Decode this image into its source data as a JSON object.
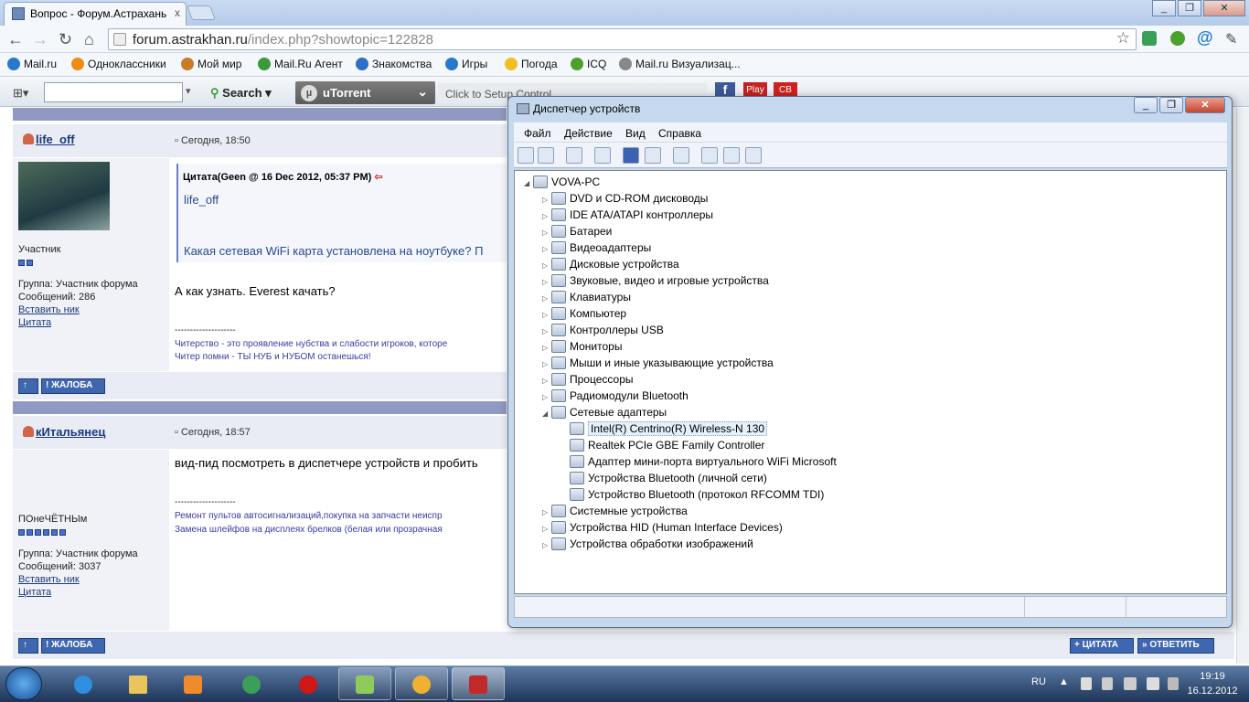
{
  "browser": {
    "tab_title": "Вопрос - Форум.Астрахань",
    "tab_close": "x",
    "url_host": "forum.astrakhan.ru",
    "url_path": "/index.php?showtopic=122828",
    "bookmarks": [
      {
        "label": "Mail.ru",
        "color": "#2a79c9"
      },
      {
        "label": "Одноклассники",
        "color": "#f08c12"
      },
      {
        "label": "Мой мир",
        "color": "#c87c2a"
      },
      {
        "label": "Mail.Ru Агент",
        "color": "#3a9a3a"
      },
      {
        "label": "Знакомства",
        "color": "#2a6fc9"
      },
      {
        "label": "Игры",
        "color": "#2a79c9"
      },
      {
        "label": "Погода",
        "color": "#f0c020"
      },
      {
        "label": "ICQ",
        "color": "#4ca02c"
      },
      {
        "label": "Mail.ru Визуализац...",
        "color": "#888888"
      }
    ],
    "search_label": "Search",
    "utorrent_label": "uTorrent",
    "setup_text": "Click to Setup Control"
  },
  "forum": {
    "posts": [
      {
        "author": "life_off",
        "date": "Сегодня, 18:50",
        "rank": "Участник",
        "pips": 2,
        "group": "Группа: Участник форума",
        "messages": "Сообщений: 286",
        "insert_nick": "Вставить ник",
        "quote_link": "Цитата",
        "quote_header": "Цитата(Geen @ 16 Dec 2012, 05:37 PM)",
        "quote_author": "life_off",
        "quote_text": "Какая сетевая WiFi карта установлена на ноутбуке? П",
        "body": "А как узнать. Everest качать?",
        "sig_line": "--------------------",
        "sig1": "Читерство - это проявление нубства и слабости игроков, которе",
        "sig2": "Читер помни - ТЫ НУБ и НУБОМ останешься!"
      },
      {
        "author": "кИтальянец",
        "date": "Сегодня, 18:57",
        "rank": "ПОнеЧЁТНЫм",
        "pips": 6,
        "group": "Группа: Участник форума",
        "messages": "Сообщений: 3037",
        "insert_nick": "Вставить ник",
        "quote_link": "Цитата",
        "body": "вид-пид посмотреть в диспетчере устройств и пробить",
        "sig_line": "--------------------",
        "sig1": "Ремонт пультов автосигнализаций,покупка на запчасти неиспр",
        "sig2": "Замена шлейфов на дисплеях брелков (белая или прозрачная"
      }
    ],
    "complain_label": "ЖАЛОБА",
    "cite_label": "ЦИТАТА",
    "reply_label": "ОТВЕТИТЬ"
  },
  "device_manager": {
    "title": "Диспетчер устройств",
    "menu": [
      "Файл",
      "Действие",
      "Вид",
      "Справка"
    ],
    "root": "VOVA-PC",
    "categories": [
      "DVD и CD-ROM дисководы",
      "IDE ATA/ATAPI контроллеры",
      "Батареи",
      "Видеоадаптеры",
      "Дисковые устройства",
      "Звуковые, видео и игровые устройства",
      "Клавиатуры",
      "Компьютер",
      "Контроллеры USB",
      "Мониторы",
      "Мыши и иные указывающие устройства",
      "Процессоры",
      "Радиомодули Bluetooth",
      "Сетевые адаптеры"
    ],
    "network_adapters": [
      "Intel(R) Centrino(R) Wireless-N 130",
      "Realtek PCIe GBE Family Controller",
      "Адаптер мини-порта виртуального WiFi Microsoft",
      "Устройства Bluetooth (личной сети)",
      "Устройство Bluetooth (протокол RFCOMM TDI)"
    ],
    "categories_after": [
      "Системные устройства",
      "Устройства HID (Human Interface Devices)",
      "Устройства обработки изображений"
    ]
  },
  "taskbar": {
    "lang": "RU",
    "time": "19:19",
    "date": "16.12.2012"
  }
}
